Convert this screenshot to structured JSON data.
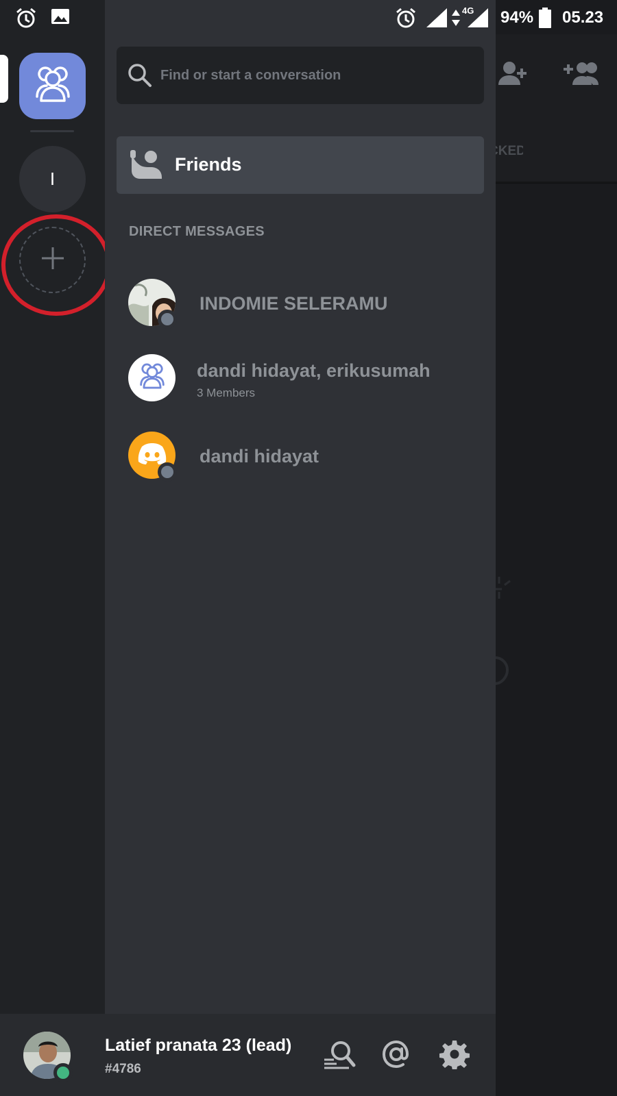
{
  "status_bar": {
    "battery": "94%",
    "network": "4G",
    "time": "05.23"
  },
  "rail": {
    "server_initial": "I"
  },
  "search": {
    "placeholder": "Find or start a conversation"
  },
  "friends": {
    "label": "Friends"
  },
  "direct_messages": {
    "header": "DIRECT MESSAGES",
    "items": [
      {
        "name": "INDOMIE SELERAMU",
        "status": "offline"
      },
      {
        "name": "dandi hidayat, erikusumah",
        "subtitle": "3 Members"
      },
      {
        "name": "dandi hidayat",
        "status": "offline"
      }
    ]
  },
  "background_tab": {
    "label": "CKED"
  },
  "user": {
    "name": "Latief pranata 23 (lead)",
    "tag": "#4786",
    "status": "online"
  },
  "colors": {
    "blurple": "#7289da",
    "online": "#43b581",
    "offline": "#747f8d",
    "highlight": "#d3202b",
    "discord_orange": "#faa61a"
  }
}
